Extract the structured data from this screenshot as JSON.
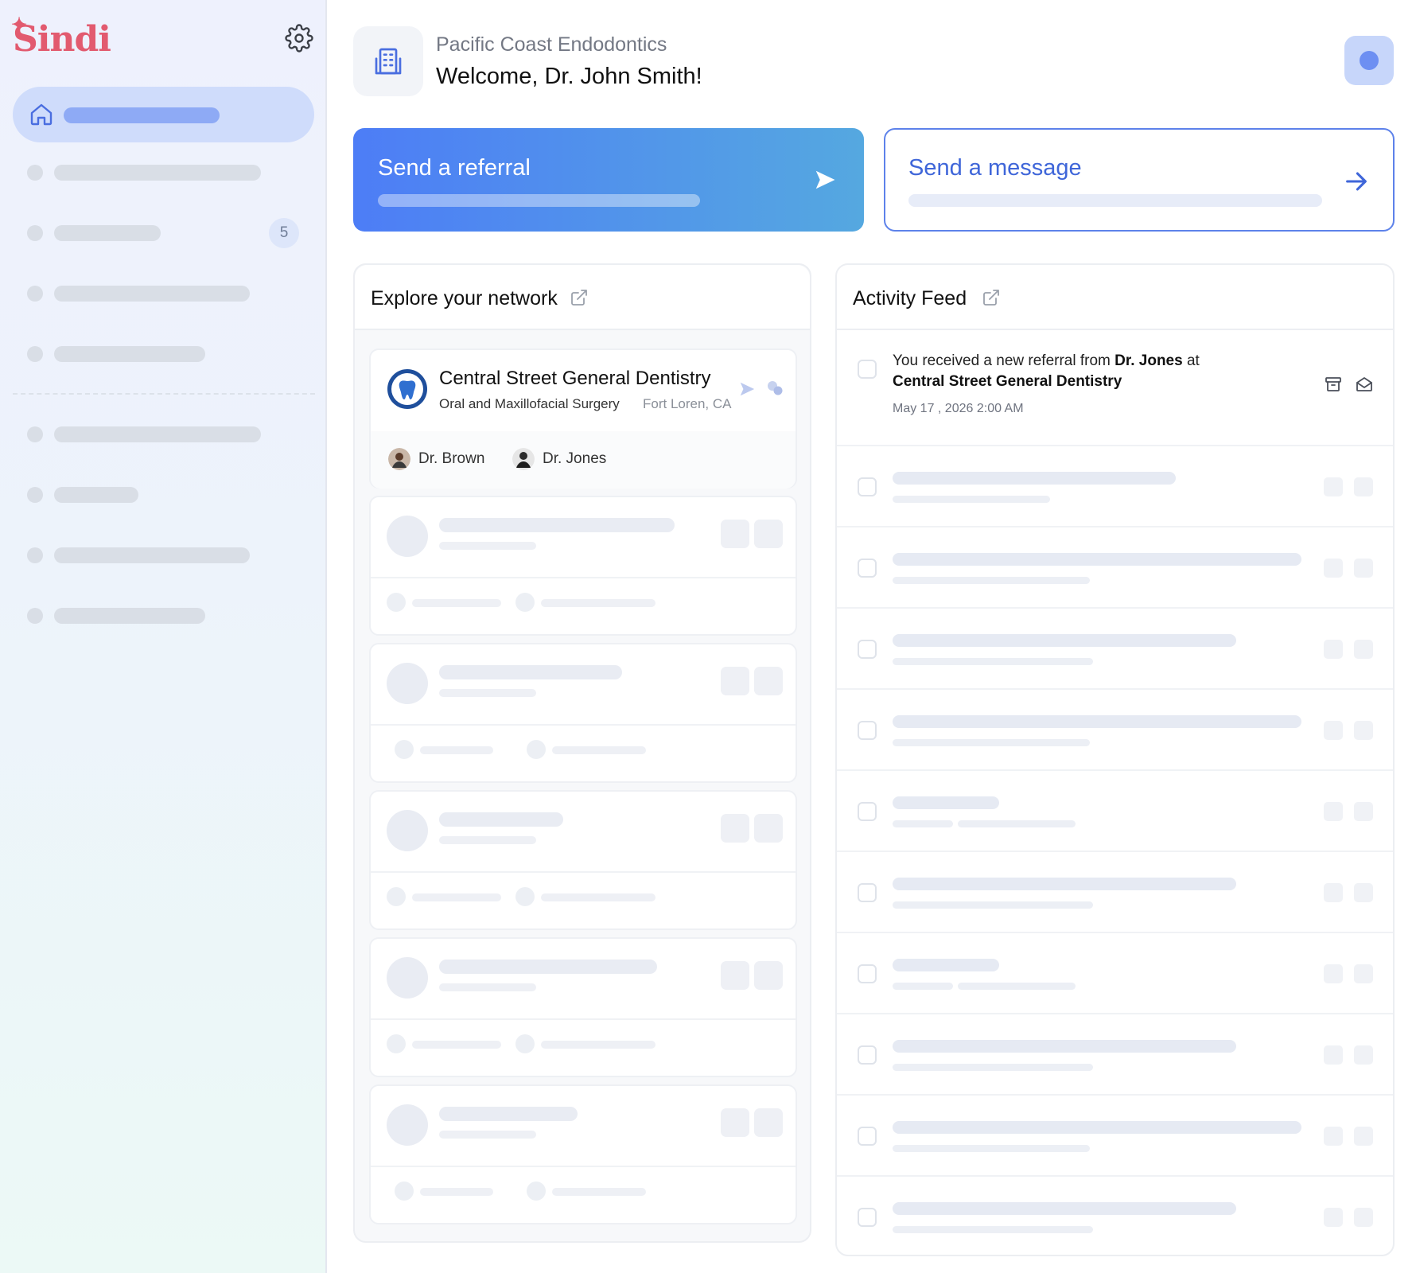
{
  "app": {
    "name": "Sindi"
  },
  "sidebar": {
    "badge_count": "5",
    "skeleton_items": 8
  },
  "header": {
    "org_name": "Pacific Coast Endodontics",
    "welcome": "Welcome, Dr. John Smith!"
  },
  "actions": {
    "referral_label": "Send a referral",
    "message_label": "Send a message"
  },
  "network": {
    "title": "Explore your network",
    "practice": {
      "name": "Central Street General Dentistry",
      "specialty": "Oral and Maxillofacial Surgery",
      "location": "Fort Loren, CA",
      "doctors": [
        {
          "name": "Dr. Brown"
        },
        {
          "name": "Dr. Jones"
        }
      ]
    }
  },
  "feed": {
    "title": "Activity Feed",
    "items": [
      {
        "text_before": "You received a new referral from ",
        "from": "Dr. Jones",
        "text_mid": " at",
        "practice": "Central Street General Dentistry",
        "date": "May 17 , 2026  2:00 AM"
      }
    ]
  },
  "colors": {
    "brand": "#e25a6f",
    "primary": "#4d7df6",
    "primary_dark": "#3f66d9"
  },
  "icons": [
    "gear-icon",
    "home-icon",
    "building-icon",
    "send-icon",
    "arrow-right-icon",
    "external-link-icon",
    "tooth-icon",
    "chat-icon",
    "archive-icon",
    "mail-open-icon"
  ]
}
